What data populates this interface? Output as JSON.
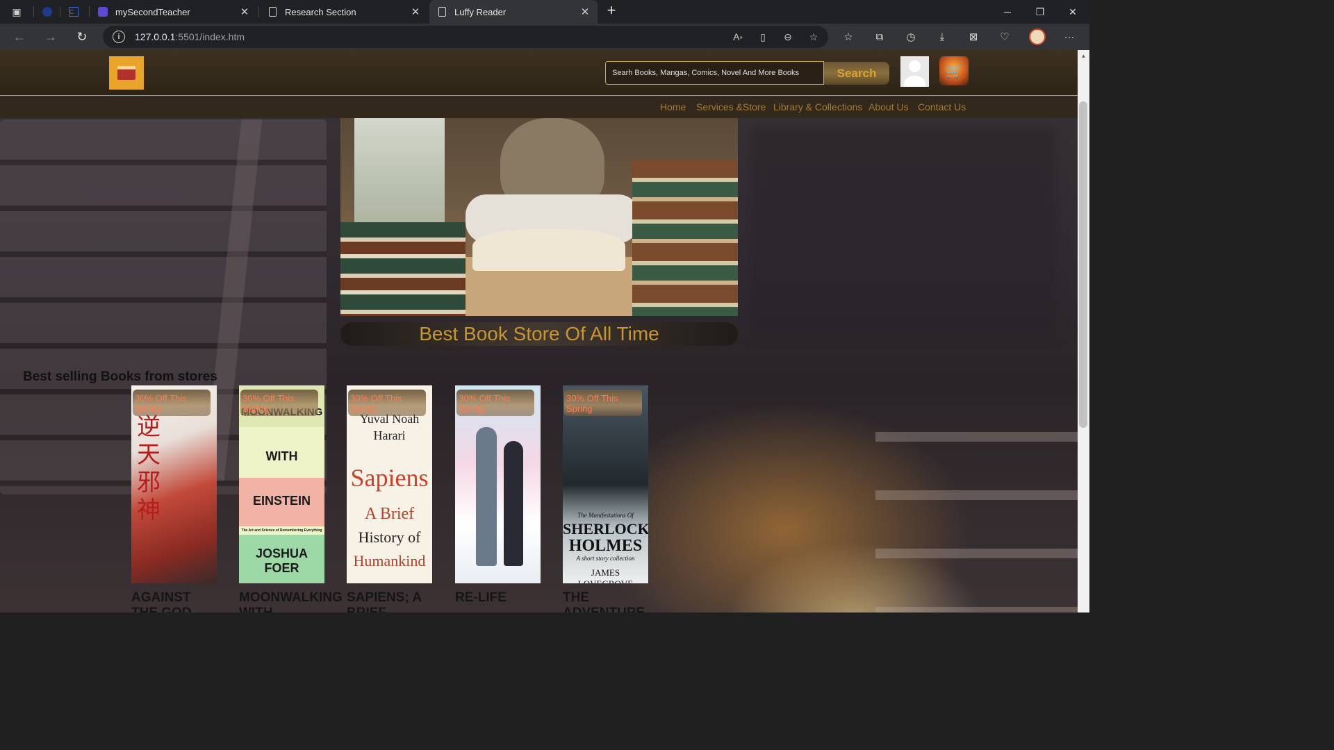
{
  "browser": {
    "tabs": [
      {
        "title": "mySecondTeacher",
        "active": false
      },
      {
        "title": "Research Section",
        "active": false
      },
      {
        "title": "Luffy Reader",
        "active": true
      }
    ],
    "url_host": "127.0.0.1",
    "url_rest": ":5501/index.htm",
    "icons": [
      "back-icon",
      "forward-icon",
      "refresh-icon",
      "read-aloud-icon",
      "reader-view-icon",
      "zoom-out-icon",
      "add-favorite-icon",
      "favorites-icon",
      "collections-icon",
      "history-icon",
      "downloads-icon",
      "math-solver-icon",
      "browser-essentials-icon",
      "profile-avatar",
      "more-icon"
    ]
  },
  "header": {
    "search_placeholder": "Searh Books, Mangas, Comics, Novel And More Books",
    "search_button": "Search"
  },
  "nav": {
    "items": [
      "Home",
      "Services &Store",
      "Library & Collections",
      "About Us",
      "Contact Us"
    ]
  },
  "hero": {
    "tagline": "Best Book Store Of All Time"
  },
  "bestselling": {
    "title": "Best selling Books from stores",
    "badge": "30% Off This Spring",
    "books": [
      {
        "title": "AGAINST",
        "title_cont": "THE GOD"
      },
      {
        "title": "MOONWALKING",
        "title_cont": "WITH",
        "cover_words": [
          "MOONWALKING",
          "WITH",
          "EINSTEIN",
          "The Art and Science of Remembering Everything",
          "JOSHUA FOER"
        ]
      },
      {
        "title": "SAPIENS; A",
        "title_cont": "BRIEF",
        "cover_words": [
          "Yuval Noah",
          "Harari",
          "Sapiens",
          "A Brief",
          "History of",
          "Humankind"
        ]
      },
      {
        "title": "RE-LIFE",
        "title_cont": ""
      },
      {
        "title": "THE",
        "title_cont": "ADVENTURE",
        "cover_words": [
          "The Manifestations Of",
          "SHERLOCK",
          "HOLMES",
          "A short story collection",
          "JAMES LOVEGROVE"
        ]
      }
    ]
  }
}
